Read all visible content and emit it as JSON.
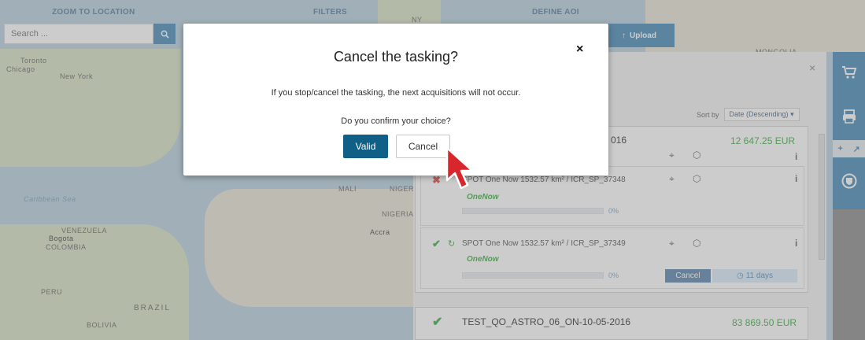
{
  "topbar": {
    "zoom_title": "ZOOM TO LOCATION",
    "search_placeholder": "Search ...",
    "filters_title": "FILTERS",
    "aoi_title": "DEFINE AOI",
    "upload_label": "Upload"
  },
  "map_labels": {
    "toronto": "Toronto",
    "chicago": "Chicago",
    "new_york": "New York",
    "caribbean": "Caribbean Sea",
    "venezuela": "VENEZUELA",
    "bogota": "Bogota",
    "colombia": "COLOMBIA",
    "peru": "PERU",
    "brazil": "BRAZIL",
    "bolivia": "BOLIVIA",
    "mali": "MALI",
    "niger": "NIGER",
    "nigeria": "NIGERIA",
    "accra": "Accra",
    "mongolia": "MONGOLIA",
    "ny": "NY"
  },
  "panel": {
    "sort_label": "Sort by",
    "sort_value": "Date (Descending)",
    "order1": {
      "date_fragment": "016",
      "price": "12 647.25 EUR"
    },
    "item1": {
      "title": "SPOT One Now 1532.57 km² / ICR_SP_37348",
      "badge": "OneNow",
      "pct": "0%"
    },
    "item2": {
      "title": "SPOT One Now 1532.57 km² / ICR_SP_37349",
      "badge": "OneNow",
      "pct": "0%",
      "cancel_label": "Cancel",
      "days_label": "11 days"
    },
    "order2": {
      "title": "TEST_QO_ASTRO_06_ON-10-05-2016",
      "price": "83 869.50 EUR"
    }
  },
  "modal": {
    "title": "Cancel the tasking?",
    "message": "If you stop/cancel the tasking, the next acquisitions will not occur.",
    "confirm": "Do you confirm your choice?",
    "valid_label": "Valid",
    "cancel_label": "Cancel",
    "close_glyph": "×"
  },
  "colors": {
    "accent": "#4a8bb8",
    "valid": "#0f5f86",
    "green": "#3fae47"
  }
}
